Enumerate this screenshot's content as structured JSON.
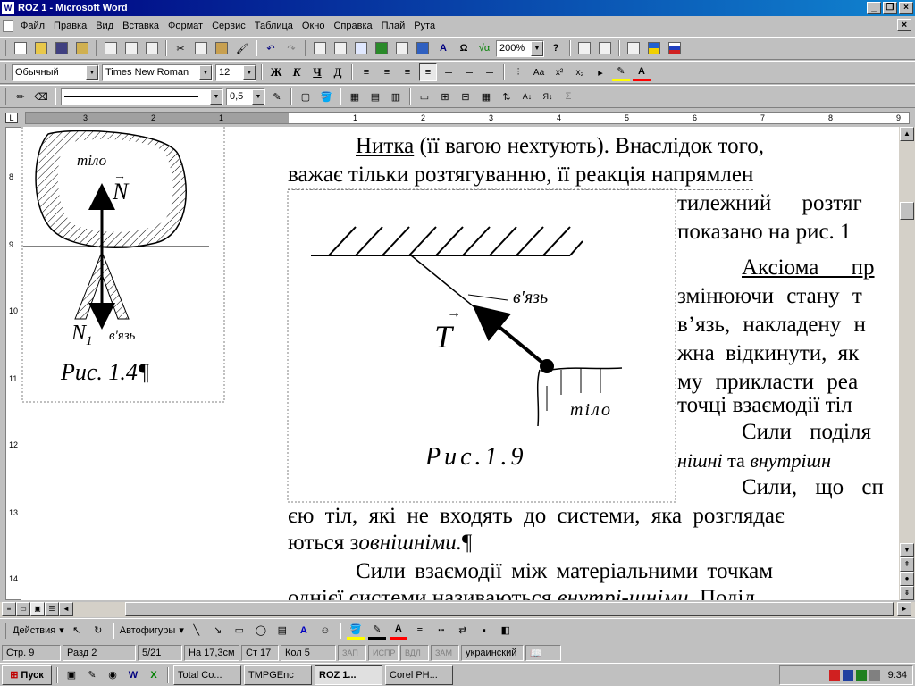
{
  "window": {
    "title": "ROZ 1 - Microsoft Word"
  },
  "menu": [
    "Файл",
    "Правка",
    "Вид",
    "Вставка",
    "Формат",
    "Сервис",
    "Таблица",
    "Окно",
    "Справка",
    "Плай",
    "Рута"
  ],
  "toolbar_standard": {
    "zoom": "200%"
  },
  "toolbar_format": {
    "style": "Обычный",
    "font": "Times New Roman",
    "size": "12",
    "bold": "Ж",
    "italic": "К",
    "underline": "Ч"
  },
  "toolbar_draw_line": {
    "weight": "0,5"
  },
  "ruler": {
    "marks": [
      "3",
      "2",
      "1",
      "1",
      "2",
      "3",
      "4",
      "5",
      "6",
      "7",
      "8",
      "9"
    ]
  },
  "vruler": {
    "marks": [
      "8",
      "9",
      "10",
      "11",
      "12",
      "13",
      "14"
    ]
  },
  "document": {
    "para1": {
      "term": "Нитка",
      "rest": " (її вагою нехтують). Внаслідок того, ",
      "line2": "важає тільки розтягуванню, її реакція напрямлен",
      "line3": "тилежний розтяг",
      "line4": "показано на рис. 1"
    },
    "para2": {
      "term": "Аксіома пр",
      "line2": "змінюючи стану т",
      "line3": "в’язь, накладену н",
      "line4": "жна відкинути, як",
      "line5": "му прикласти реа",
      "line6": "точці взаємодії тіл"
    },
    "para3": {
      "line1": "Сили поділя",
      "ital1": "нішні",
      "mid": " та ",
      "ital2": "внутрішн"
    },
    "para4": {
      "line1": "Сили, що сп",
      "line2": "єю тіл, які не входять до системи, яка розглядає",
      "line3a": "ються з",
      "line3b": "овнішніми.",
      "pilcrow": "¶"
    },
    "para5": {
      "line1": "Сили взаємодії між матеріальними точкам",
      "line2a": "однієї системи називаються ",
      "line2b": "внутрі-шніми",
      "line2c": ". Поділ"
    },
    "fig1": {
      "body_label": "тіло",
      "force": "N",
      "reaction": "N",
      "reaction_sub": "1",
      "link_label": "в'язь",
      "caption": "Рис. 1.4¶"
    },
    "fig2": {
      "force": "T",
      "link_label": "в'язь",
      "body_label": "тіло",
      "caption": "Рис.1.9"
    }
  },
  "drawbar": {
    "actions": "Действия",
    "autoshapes": "Автофигуры"
  },
  "status": {
    "page": "Стр. 9",
    "section": "Разд 2",
    "pages": "5/21",
    "at": "На 17,3см",
    "line": "Ст 17",
    "col": "Кол 5",
    "rec": "ЗАП",
    "trk": "ИСПР",
    "ext": "ВДЛ",
    "ovr": "ЗАМ",
    "lang": "украинский"
  },
  "taskbar": {
    "start": "Пуск",
    "tasks": [
      "Total Co...",
      "TMPGEnc",
      "ROZ 1...",
      "Corel PH..."
    ],
    "clock": "9:34"
  },
  "colors": {
    "title_start": "#000080",
    "title_end": "#1084d0",
    "chrome": "#c0c0c0"
  }
}
